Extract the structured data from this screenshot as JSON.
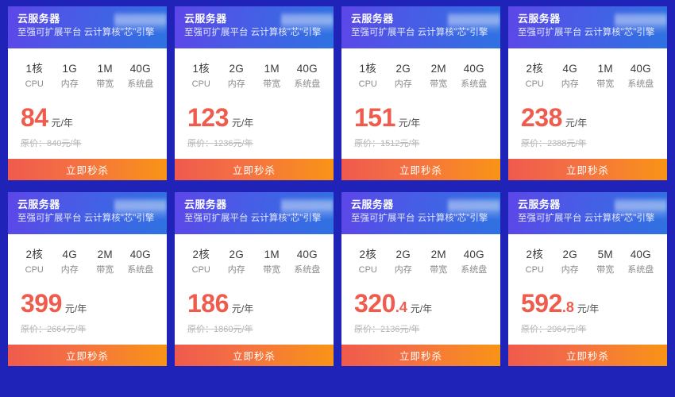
{
  "page": {
    "background_color": "#1f23b8",
    "accent_color": "#ef5b4c",
    "header_gradient_from": "#5d46e8",
    "header_gradient_to": "#2f72e2",
    "button_gradient_from": "#ef5a4d",
    "button_gradient_to": "#f99416"
  },
  "common": {
    "title": "云服务器",
    "subtitle": "至强可扩展平台 云计算核\"芯\"引擎",
    "buy_label": "立即秒杀",
    "price_unit": "元/年",
    "spec_labels": [
      "CPU",
      "内存",
      "带宽",
      "系统盘"
    ],
    "redacted_label": "redacted-block"
  },
  "cards": [
    {
      "title": "云服务器",
      "subtitle": "至强可扩展平台 云计算核\"芯\"引擎",
      "specs": [
        {
          "value": "1核",
          "label": "CPU"
        },
        {
          "value": "1G",
          "label": "内存"
        },
        {
          "value": "1M",
          "label": "带宽"
        },
        {
          "value": "40G",
          "label": "系统盘"
        }
      ],
      "price_int": "84",
      "price_dec": "",
      "price_unit": "元/年",
      "original_price": "原价：840元/年",
      "buy_label": "立即秒杀"
    },
    {
      "title": "云服务器",
      "subtitle": "至强可扩展平台 云计算核\"芯\"引擎",
      "specs": [
        {
          "value": "1核",
          "label": "CPU"
        },
        {
          "value": "2G",
          "label": "内存"
        },
        {
          "value": "1M",
          "label": "带宽"
        },
        {
          "value": "40G",
          "label": "系统盘"
        }
      ],
      "price_int": "123",
      "price_dec": "",
      "price_unit": "元/年",
      "original_price": "原价：1236元/年",
      "buy_label": "立即秒杀"
    },
    {
      "title": "云服务器",
      "subtitle": "至强可扩展平台 云计算核\"芯\"引擎",
      "specs": [
        {
          "value": "1核",
          "label": "CPU"
        },
        {
          "value": "2G",
          "label": "内存"
        },
        {
          "value": "2M",
          "label": "带宽"
        },
        {
          "value": "40G",
          "label": "系统盘"
        }
      ],
      "price_int": "151",
      "price_dec": "",
      "price_unit": "元/年",
      "original_price": "原价：1512元/年",
      "buy_label": "立即秒杀"
    },
    {
      "title": "云服务器",
      "subtitle": "至强可扩展平台 云计算核\"芯\"引擎",
      "specs": [
        {
          "value": "2核",
          "label": "CPU"
        },
        {
          "value": "4G",
          "label": "内存"
        },
        {
          "value": "1M",
          "label": "带宽"
        },
        {
          "value": "40G",
          "label": "系统盘"
        }
      ],
      "price_int": "238",
      "price_dec": "",
      "price_unit": "元/年",
      "original_price": "原价：2388元/年",
      "buy_label": "立即秒杀"
    },
    {
      "title": "云服务器",
      "subtitle": "至强可扩展平台 云计算核\"芯\"引擎",
      "specs": [
        {
          "value": "2核",
          "label": "CPU"
        },
        {
          "value": "4G",
          "label": "内存"
        },
        {
          "value": "2M",
          "label": "带宽"
        },
        {
          "value": "40G",
          "label": "系统盘"
        }
      ],
      "price_int": "399",
      "price_dec": "",
      "price_unit": "元/年",
      "original_price": "原价：2664元/年",
      "buy_label": "立即秒杀"
    },
    {
      "title": "云服务器",
      "subtitle": "至强可扩展平台 云计算核\"芯\"引擎",
      "specs": [
        {
          "value": "2核",
          "label": "CPU"
        },
        {
          "value": "2G",
          "label": "内存"
        },
        {
          "value": "1M",
          "label": "带宽"
        },
        {
          "value": "40G",
          "label": "系统盘"
        }
      ],
      "price_int": "186",
      "price_dec": "",
      "price_unit": "元/年",
      "original_price": "原价：1860元/年",
      "buy_label": "立即秒杀"
    },
    {
      "title": "云服务器",
      "subtitle": "至强可扩展平台 云计算核\"芯\"引擎",
      "specs": [
        {
          "value": "2核",
          "label": "CPU"
        },
        {
          "value": "2G",
          "label": "内存"
        },
        {
          "value": "2M",
          "label": "带宽"
        },
        {
          "value": "40G",
          "label": "系统盘"
        }
      ],
      "price_int": "320",
      "price_dec": ".4",
      "price_unit": "元/年",
      "original_price": "原价：2136元/年",
      "buy_label": "立即秒杀"
    },
    {
      "title": "云服务器",
      "subtitle": "至强可扩展平台 云计算核\"芯\"引擎",
      "specs": [
        {
          "value": "2核",
          "label": "CPU"
        },
        {
          "value": "2G",
          "label": "内存"
        },
        {
          "value": "5M",
          "label": "带宽"
        },
        {
          "value": "40G",
          "label": "系统盘"
        }
      ],
      "price_int": "592",
      "price_dec": ".8",
      "price_unit": "元/年",
      "original_price": "原价：2964元/年",
      "buy_label": "立即秒杀"
    }
  ]
}
